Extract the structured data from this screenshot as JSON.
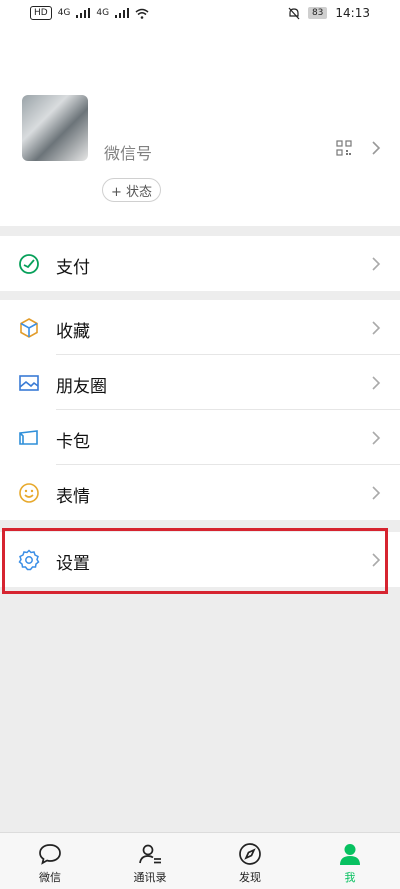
{
  "status_bar": {
    "hd": "HD",
    "net1": "4G",
    "net2": "4G",
    "battery": "83",
    "time": "14:13"
  },
  "profile": {
    "wechat_id_label": "微信号",
    "status_button_label": "+ 状态"
  },
  "menu": {
    "pay": "支付",
    "favorites": "收藏",
    "moments": "朋友圈",
    "cards": "卡包",
    "stickers": "表情",
    "settings": "设置"
  },
  "tabs": [
    "微信",
    "通讯录",
    "发现",
    "我"
  ],
  "colors": {
    "accent": "#07c160",
    "highlight": "#d62430",
    "background": "#ededed"
  },
  "icons": {
    "pay": "wallet-icon",
    "favorites": "cube-icon",
    "moments": "picture-icon",
    "cards": "card-icon",
    "stickers": "smile-icon",
    "settings": "gear-icon"
  }
}
